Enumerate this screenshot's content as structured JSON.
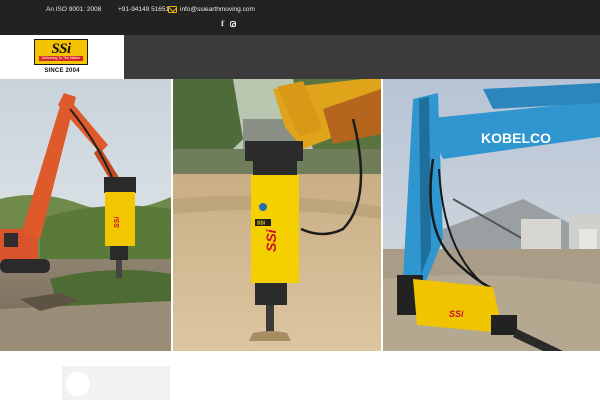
{
  "topbar": {
    "iso": "An ISO 9001: 2008",
    "phone": "+91-94149 51651",
    "email": "info@ssiearthmoving.com",
    "social_icons": [
      "facebook-icon",
      "instagram-icon"
    ]
  },
  "brand": {
    "logo_text": "SSi",
    "tagline": "Delivering To The Nation",
    "since": "SINCE 2004"
  },
  "gallery": {
    "photos": [
      {
        "subject": "orange excavator with yellow hydraulic breaker",
        "brand_text": "SSi"
      },
      {
        "subject": "yellow hydraulic breaker on sand",
        "brand_text": "SSi"
      },
      {
        "subject": "blue Kobelco excavator with yellow breaker",
        "boom_text": "KOBELCO",
        "brand_text": "SSi"
      }
    ]
  },
  "colors": {
    "topbar": "#222222",
    "navbar": "#3b3b3b",
    "accent": "#f5c400",
    "mail_icon": "#f0b400"
  }
}
